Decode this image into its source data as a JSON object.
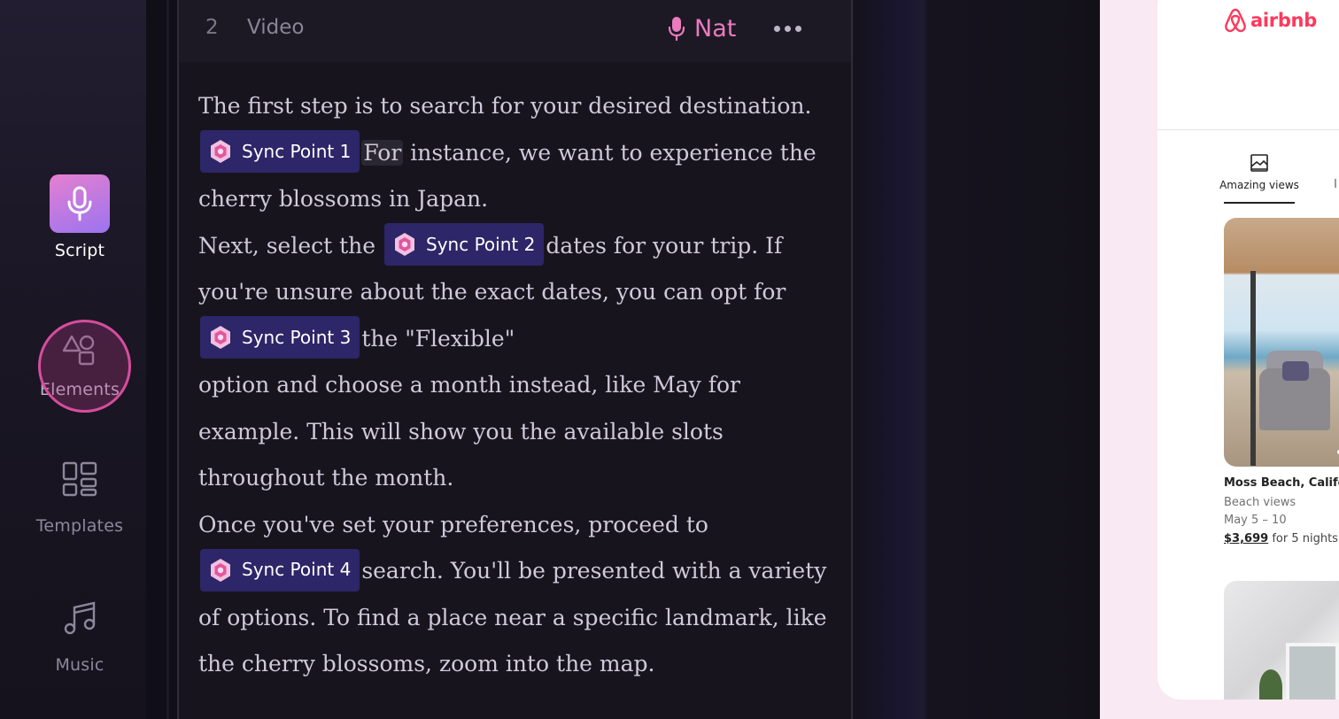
{
  "sidebar": {
    "items": [
      {
        "label": "Script",
        "icon": "microphone-icon",
        "active": true
      },
      {
        "label": "Elements",
        "icon": "shapes-icon",
        "active": false
      },
      {
        "label": "Templates",
        "icon": "layout-grid-icon",
        "active": false
      },
      {
        "label": "Music",
        "icon": "music-note-icon",
        "active": false
      }
    ]
  },
  "editor": {
    "scene_number": "2",
    "scene_type": "Video",
    "voice_name": "Nat",
    "more_icon": "more-horizontal-icon",
    "script": {
      "p1_a": "The first step is to search for your desired destination.",
      "sync1": "Sync Point 1",
      "p1_highlight": "For",
      "p1_b": "instance, we want to experience the cherry blossoms in Japan.",
      "p2_a": "Next, select the",
      "sync2": "Sync Point 2",
      "p2_b": "dates for your trip. If you're unsure about the exact dates, you can opt for",
      "sync3": "Sync Point 3",
      "p2_c": "the \"Flexible\"",
      "p2_d": "option and choose a month instead, like May for example. This will show you the available slots throughout the month.",
      "p3_a": "Once you've set your preferences, proceed to",
      "sync4": "Sync Point 4",
      "p3_b": "search. You'll be presented with a variety of options. To find a place near a specific landmark, like the cherry blossoms, zoom into the map."
    }
  },
  "preview": {
    "brand": "airbnb",
    "category_label": "Amazing views",
    "listing": {
      "title": "Moss Beach, Califor",
      "subtitle": "Beach views",
      "dates": "May 5 – 10",
      "price": "$3,699",
      "price_suffix": "for 5 nights"
    }
  },
  "colors": {
    "accent_pink": "#ea7bbd",
    "sync_chip_bg": "#2d2668",
    "airbnb_red": "#ff385c",
    "active_nav_gradient_start": "#e57fd0",
    "active_nav_gradient_end": "#9b74f0"
  }
}
